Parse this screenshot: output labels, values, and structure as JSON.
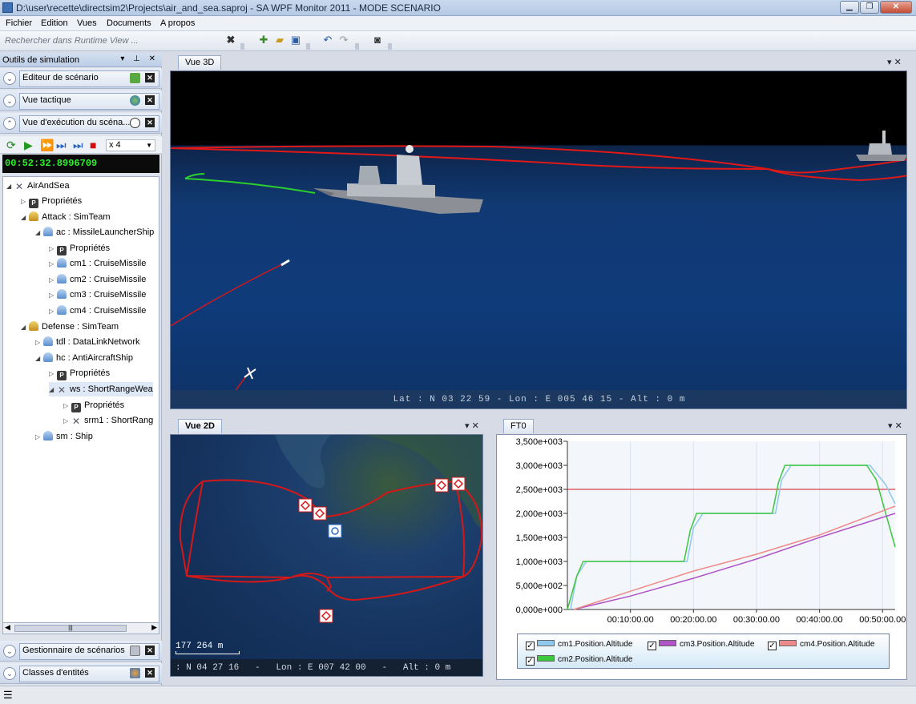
{
  "window": {
    "title": "D:\\user\\recette\\directsim2\\Projects\\air_and_sea.saproj - SA WPF Monitor 2011 - MODE SCENARIO"
  },
  "menu": [
    "Fichier",
    "Edition",
    "Vues",
    "Documents",
    "A propos"
  ],
  "toolbar": {
    "search_placeholder": "Rechercher dans Runtime View ..."
  },
  "left_panel": {
    "title": "Outils de simulation",
    "sections": {
      "editor": "Editeur de scénario",
      "tactical": "Vue tactique",
      "execution": "Vue d'exécution du scéna...",
      "manager": "Gestionnaire de scénarios",
      "classes": "Classes d'entités"
    },
    "speed": "x 4",
    "clock": "00:52:32.8996709",
    "tree": [
      {
        "label": "AirAndSea"
      },
      {
        "label": "Propriétés"
      },
      {
        "label": "Attack : SimTeam"
      },
      {
        "label": "ac : MissileLauncherShip"
      },
      {
        "label": "Propriétés"
      },
      {
        "label": "cm1 : CruiseMissile"
      },
      {
        "label": "cm2 : CruiseMissile"
      },
      {
        "label": "cm3 : CruiseMissile"
      },
      {
        "label": "cm4 : CruiseMissile"
      },
      {
        "label": "Defense : SimTeam"
      },
      {
        "label": "tdl : DataLinkNetwork"
      },
      {
        "label": "hc : AntiAircraftShip"
      },
      {
        "label": "Propriétés"
      },
      {
        "label": "ws : ShortRangeWea"
      },
      {
        "label": "Propriétés"
      },
      {
        "label": "srm1 : ShortRang"
      },
      {
        "label": "sm : Ship"
      }
    ]
  },
  "view3d": {
    "tab": "Vue 3D",
    "status": "Lat : N 03 22 59   -   Lon : E 005 46 15   -   Alt :  0 m"
  },
  "view2d": {
    "tab": "Vue 2D",
    "scale": "177 264 m",
    "status": ": N 04 27 16   -   Lon : E 007 42 00   -   Alt : 0 m"
  },
  "ft0": {
    "tab": "FT0",
    "legend": [
      {
        "label": "cm1.Position.Altitude",
        "color": "#8fc8ef"
      },
      {
        "label": "cm3.Position.Altitude",
        "color": "#b055c8"
      },
      {
        "label": "cm4.Position.Altitude",
        "color": "#ef8a8a"
      },
      {
        "label": "cm2.Position.Altitude",
        "color": "#3cc83c"
      }
    ]
  },
  "chart_data": {
    "type": "line",
    "xlabel": "",
    "ylabel": "",
    "x_ticks": [
      "00:10:00.00",
      "00:20:00.00",
      "00:30:00.00",
      "00:40:00.00",
      "00:50:00.00"
    ],
    "y_ticks": [
      "0,000e+000",
      "5,000e+002",
      "1,000e+003",
      "1,500e+003",
      "2,000e+003",
      "2,500e+003",
      "3,000e+003",
      "3,500e+003"
    ],
    "ylim": [
      0,
      3500
    ],
    "xlim_minutes": [
      0,
      52
    ],
    "threshold": 2500,
    "series": [
      {
        "name": "cm1.Position.Altitude",
        "color": "#8fc8ef",
        "x": [
          0.5,
          1.5,
          3,
          19,
          20,
          21.5,
          33,
          34,
          35.5,
          46,
          47,
          48,
          50.5,
          52
        ],
        "y": [
          0,
          700,
          1000,
          1000,
          1700,
          2000,
          2000,
          2700,
          3000,
          3000,
          3000,
          3000,
          2600,
          2200
        ]
      },
      {
        "name": "cm2.Position.Altitude",
        "color": "#3cc83c",
        "x": [
          0,
          1.5,
          2.5,
          18.5,
          19.5,
          20.5,
          32.5,
          33.5,
          34.5,
          47.5,
          49,
          52
        ],
        "y": [
          0,
          700,
          1000,
          1000,
          1650,
          2000,
          2000,
          2650,
          3000,
          3000,
          2700,
          1300
        ]
      },
      {
        "name": "cm3.Position.Altitude",
        "color": "#b055c8",
        "x": [
          1,
          10,
          20,
          30,
          40,
          52
        ],
        "y": [
          0,
          280,
          650,
          1050,
          1500,
          2000
        ]
      },
      {
        "name": "cm4.Position.Altitude",
        "color": "#ef8a8a",
        "x": [
          1,
          10,
          20,
          30,
          40,
          52
        ],
        "y": [
          0,
          380,
          800,
          1150,
          1550,
          2150
        ]
      }
    ]
  }
}
